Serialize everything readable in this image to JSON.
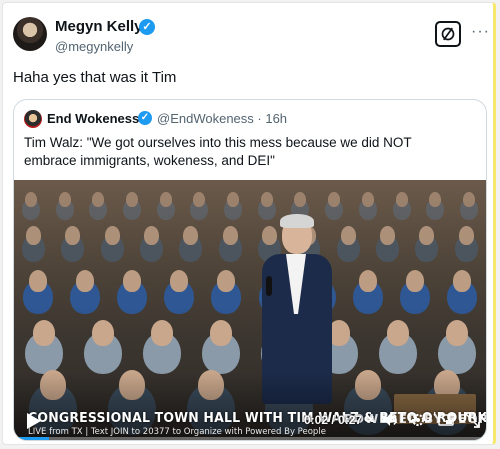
{
  "tweet": {
    "author_name": "Megyn Kelly",
    "author_handle": "@megynkelly",
    "verified_glyph": "✓",
    "text": "Haha yes that was it Tim",
    "more_glyph": "···"
  },
  "quoted": {
    "author_name": "End Wokeness",
    "author_handle": "@EndWokeness",
    "age": "16h",
    "meta": "@EndWokeness · 16h",
    "verified_glyph": "✓",
    "text": "Tim Walz: \"We got ourselves into this mess because we did NOT embrace immigrants, wokeness, and DEI\""
  },
  "video": {
    "banner": "CONGRESSIONAL TOWN HALL WITH TIM WALZ & BETO O'ROURKE",
    "brand": "POWERED BY PEOPLE",
    "ticker": "LIVE from TX  |  Text JOIN to 20377 to Organize with Powered By People",
    "time": "0:02 / 0:27",
    "progress_fraction": 0.074
  },
  "icons": {
    "grok": "grok-icon",
    "more": "more-icon",
    "play": "play-icon",
    "volume": "volume-icon",
    "settings": "settings-icon",
    "pip": "picture-in-picture-icon",
    "fullscreen": "fullscreen-icon"
  },
  "colors": {
    "accent": "#1d9bf0",
    "text": "#0f1419",
    "muted": "#536471"
  }
}
